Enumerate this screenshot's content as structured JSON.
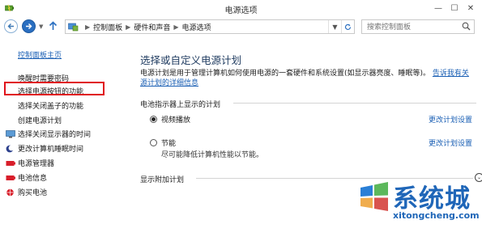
{
  "window": {
    "title": "电源选项",
    "minimize_glyph": "—",
    "maximize_glyph": "☐",
    "close_glyph": "✕"
  },
  "navbar": {
    "breadcrumbs": [
      "控制面板",
      "硬件和声音",
      "电源选项"
    ],
    "search_placeholder": "搜索控制面板"
  },
  "sidebar": {
    "home_label": "控制面板主页",
    "items": [
      {
        "label": "唤醒时需要密码"
      },
      {
        "label": "选择电源按钮的功能",
        "highlighted": true
      },
      {
        "label": "选择关闭盖子的功能"
      },
      {
        "label": "创建电源计划"
      },
      {
        "label": "选择关闭显示器的时间",
        "icon": "monitor-icon"
      },
      {
        "label": "更改计算机睡眠时间",
        "icon": "moon-icon"
      }
    ],
    "related": [
      {
        "label": "电源管理器",
        "icon": "battery-icon"
      },
      {
        "label": "电池信息",
        "icon": "battery-icon"
      },
      {
        "label": "购买电池",
        "icon": "globe-icon"
      }
    ],
    "highlight_color": "#e0111b"
  },
  "main": {
    "heading": "选择或自定义电源计划",
    "description_text": "电源计划是用于管理计算机如何使用电源的一套硬件和系统设置(如显示器亮度、睡眠等)。",
    "description_link_1": "告诉我有关",
    "description_link_2": "源计划的详细信息",
    "battery_section_label": "电池指示器上显示的计划",
    "plans": [
      {
        "name": "视频播放",
        "selected": true,
        "change_label": "更改计划设置",
        "description": ""
      },
      {
        "name": "节能",
        "selected": false,
        "change_label": "更改计划设置",
        "description": "尽可能降低计算机性能以节能。"
      }
    ],
    "additional_plans_label": "显示附加计划",
    "expand_glyph": "⌄"
  },
  "watermark": {
    "text": "系统城",
    "url": "xitongcheng.com"
  },
  "colors": {
    "link": "#1a5fb4",
    "accent_blue": "#2a6fc1",
    "heading": "#1e3a5f"
  }
}
